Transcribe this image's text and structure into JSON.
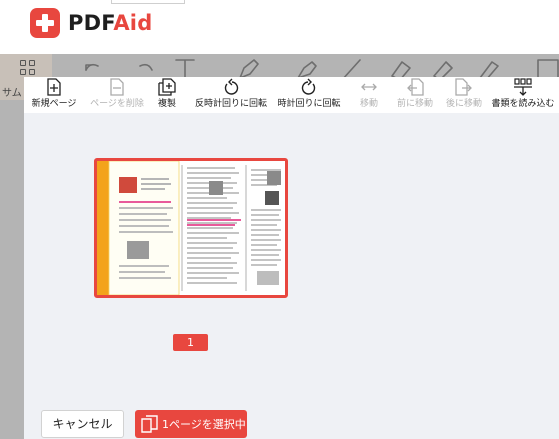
{
  "brand": {
    "name_part1": "PDF",
    "name_part2": "Aid",
    "accent": "#e8473f"
  },
  "background_editor": {
    "thumbnail_tab_label": "サム",
    "tool_icons": [
      "undo-icon",
      "redo-icon",
      "text-icon",
      "pen-icon",
      "marker-icon",
      "line-icon",
      "eraser-icon",
      "highlighter-icon",
      "pencil-icon",
      "text-box-icon"
    ]
  },
  "toolbar": {
    "add_page": "新規ページ",
    "delete_page": "ページを削除",
    "duplicate": "複製",
    "rotate_ccw": "反時計回りに回転",
    "rotate_cw": "時計回りに回転",
    "move": "移動",
    "move_back": "前に移動",
    "move_forward": "後に移動",
    "load_document": "書類を読み込む"
  },
  "pages": [
    {
      "number": "1",
      "selected": true
    }
  ],
  "footer": {
    "cancel": "キャンセル",
    "select_count": "1ページを選択中"
  }
}
